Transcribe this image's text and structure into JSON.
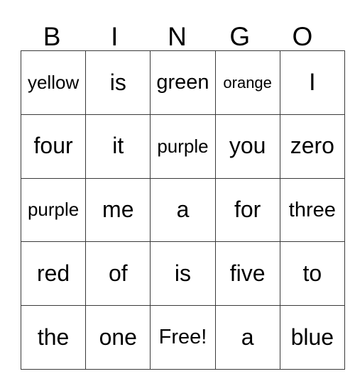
{
  "card": {
    "header_letters": [
      "B",
      "I",
      "N",
      "G",
      "O"
    ],
    "rows": [
      [
        {
          "text": "yellow",
          "size": "sm"
        },
        {
          "text": "is",
          "size": "lg"
        },
        {
          "text": "green",
          "size": "md"
        },
        {
          "text": "orange",
          "size": "xs"
        },
        {
          "text": "I",
          "size": "xl"
        }
      ],
      [
        {
          "text": "four",
          "size": "lg"
        },
        {
          "text": "it",
          "size": "lg"
        },
        {
          "text": "purple",
          "size": "sm"
        },
        {
          "text": "you",
          "size": "lg"
        },
        {
          "text": "zero",
          "size": "lg"
        }
      ],
      [
        {
          "text": "purple",
          "size": "sm"
        },
        {
          "text": "me",
          "size": "lg"
        },
        {
          "text": "a",
          "size": "lg"
        },
        {
          "text": "for",
          "size": "lg"
        },
        {
          "text": "three",
          "size": "md"
        }
      ],
      [
        {
          "text": "red",
          "size": "lg"
        },
        {
          "text": "of",
          "size": "lg"
        },
        {
          "text": "is",
          "size": "lg"
        },
        {
          "text": "five",
          "size": "lg"
        },
        {
          "text": "to",
          "size": "lg"
        }
      ],
      [
        {
          "text": "the",
          "size": "lg"
        },
        {
          "text": "one",
          "size": "lg"
        },
        {
          "text": "Free!",
          "size": "md"
        },
        {
          "text": "a",
          "size": "lg"
        },
        {
          "text": "blue",
          "size": "lg"
        }
      ]
    ],
    "colors": {
      "background": "#ffffff",
      "text": "#000000",
      "grid_line": "#3a3a3a"
    }
  }
}
